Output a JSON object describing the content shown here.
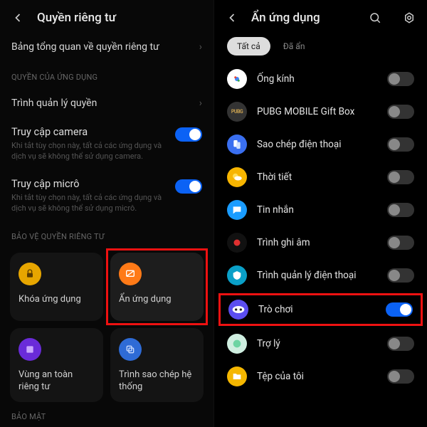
{
  "left": {
    "title": "Quyền riêng tư",
    "overview": "Bảng tổng quan về quyền riêng tư",
    "section_app_perms": "QUYỀN CỦA ỨNG DỤNG",
    "perm_manager": "Trình quản lý quyền",
    "camera": {
      "title": "Truy cập camera",
      "sub": "Khi tắt tùy chọn này, tất cả các ứng dụng và dịch vụ sẽ không thể sử dụng camera."
    },
    "micro": {
      "title": "Truy cập micrô",
      "sub": "Khi tắt tùy chọn này, tất cả các ứng dụng và dịch vụ sẽ không thể sử dụng micrô."
    },
    "section_protect": "BẢO VỆ QUYỀN RIÊNG TƯ",
    "tiles": {
      "lock": "Khóa ứng dụng",
      "hide": "Ẩn ứng dụng",
      "safezone": "Vùng an toàn riêng tư",
      "sysclone": "Trình sao chép hệ thống"
    },
    "section_security": "BẢO MẬT"
  },
  "right": {
    "title": "Ẩn ứng dụng",
    "tabs": {
      "all": "Tất cả",
      "hidden": "Đã ẩn"
    },
    "apps": [
      {
        "name": "Ống kính",
        "on": false,
        "color": "#fff",
        "glyph": "lens"
      },
      {
        "name": "PUBG MOBILE Gift Box",
        "on": false,
        "color": "#333",
        "glyph": "pubg"
      },
      {
        "name": "Sao chép điện thoại",
        "on": false,
        "color": "#3a6ff0",
        "glyph": "clone"
      },
      {
        "name": "Thời tiết",
        "on": false,
        "color": "#f7b500",
        "glyph": "weather"
      },
      {
        "name": "Tin nhắn",
        "on": false,
        "color": "#1a9cff",
        "glyph": "msg"
      },
      {
        "name": "Trình ghi âm",
        "on": false,
        "color": "#111",
        "glyph": "rec"
      },
      {
        "name": "Trình quản lý điện thoại",
        "on": false,
        "color": "#0aa0c8",
        "glyph": "mgr"
      },
      {
        "name": "Trò chơi",
        "on": true,
        "color": "#5b4ef0",
        "glyph": "game"
      },
      {
        "name": "Trợ lý",
        "on": false,
        "color": "#cfeee0",
        "glyph": "assist"
      },
      {
        "name": "Tệp của tôi",
        "on": false,
        "color": "#f5b700",
        "glyph": "files"
      }
    ]
  }
}
